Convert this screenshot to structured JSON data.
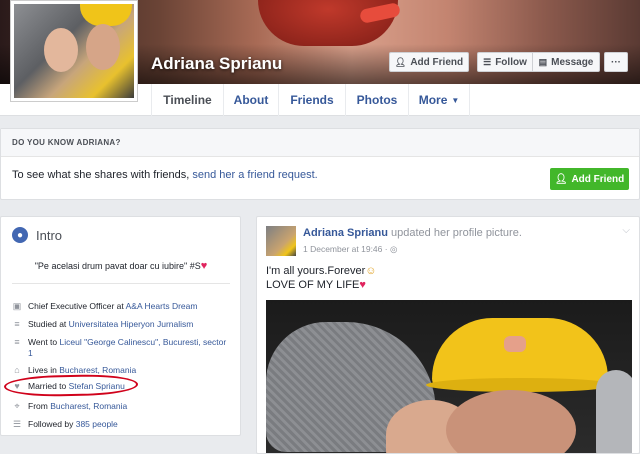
{
  "profile": {
    "name": "Adriana Sprianu"
  },
  "actions": {
    "add_friend": "Add Friend",
    "follow": "Follow",
    "message": "Message",
    "more": "···"
  },
  "tabs": [
    {
      "label": "Timeline",
      "active": true
    },
    {
      "label": "About"
    },
    {
      "label": "Friends"
    },
    {
      "label": "Photos"
    },
    {
      "label": "More"
    }
  ],
  "know_panel": {
    "heading": "DO YOU KNOW ADRIANA?",
    "text": "To see what she shares with friends, ",
    "link": "send her a friend request.",
    "button": "Add Friend"
  },
  "intro": {
    "title": "Intro",
    "bio": "\"Pe acelasi drum pavat doar cu iubire\" #S",
    "items": [
      {
        "icon": "briefcase-icon",
        "text": "Chief Executive Officer at ",
        "link": "A&A Hearts Dream"
      },
      {
        "icon": "graduation-icon",
        "text": "Studied at ",
        "link": "Universitatea Hiperyon Jurnalism"
      },
      {
        "icon": "graduation-icon",
        "text": "Went to ",
        "link": "Liceul \"George Calinescu\", Bucuresti, sector 1"
      },
      {
        "icon": "home-icon",
        "text": "Lives in ",
        "link": "Bucharest, Romania"
      },
      {
        "icon": "heart-icon",
        "text": "Married to ",
        "link": "Stefan Sprianu"
      },
      {
        "icon": "location-icon",
        "text": "From ",
        "link": "Bucharest, Romania"
      },
      {
        "icon": "rss-icon",
        "text": "Followed by ",
        "link": "385 people"
      }
    ]
  },
  "post": {
    "author": "Adriana Sprianu",
    "action": " updated her profile picture.",
    "time": "1 December at 19:46",
    "line1": "I'm all yours.Forever",
    "line2": "LOVE OF MY LIFE"
  },
  "colors": {
    "link": "#365899",
    "green": "#42b72a",
    "highlight": "#d0021b"
  }
}
